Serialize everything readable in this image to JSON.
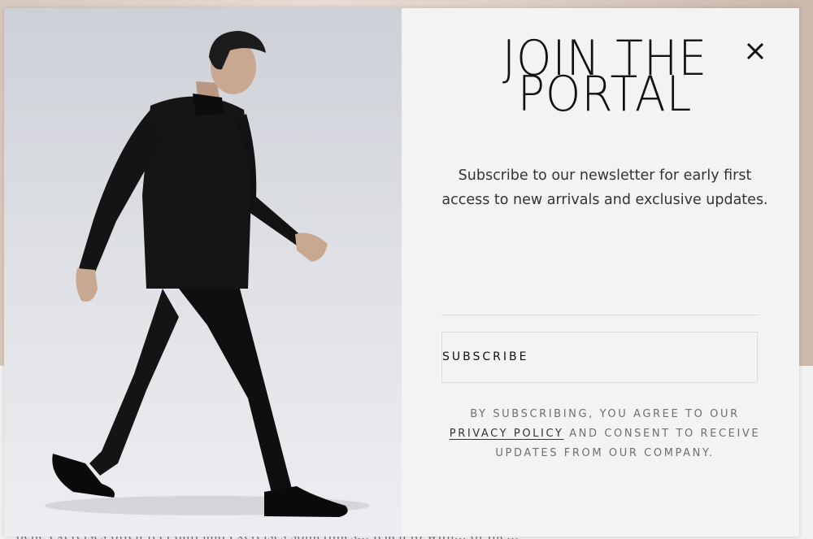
{
  "modal": {
    "title_line1": "JOIN THE",
    "title_line2": "PORTAL",
    "description": "Subscribe to our newsletter for early first access to new arrivals and exclusive updates.",
    "subscribe_label": "SUBSCRIBE",
    "consent_prefix": "BY SUBSCRIBING, YOU AGREE TO OUR",
    "privacy_link": "PRIVACY POLICY",
    "consent_suffix": "AND CONSENT TO RECEIVE UPDATES FROM OUR COMPANY.",
    "close_icon": "close-icon"
  },
  "background": {
    "partial_text": "oche exercises   often feel dull   and exercises   sometimes... teach to with... of the..."
  }
}
